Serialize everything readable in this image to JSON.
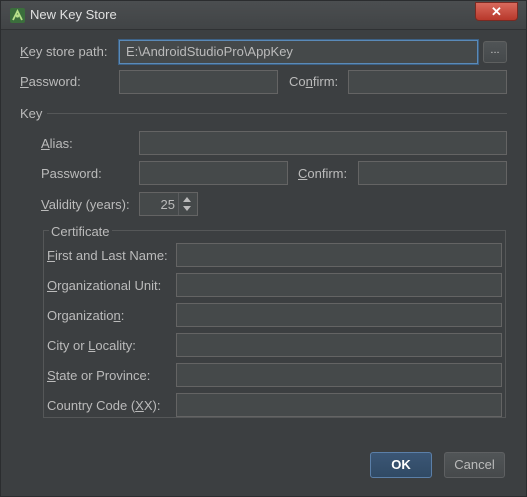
{
  "window": {
    "title": "New Key Store",
    "close_label": "✕"
  },
  "keystore": {
    "path_label_u": "K",
    "path_label_rest": "ey store path:",
    "path_value": "E:\\AndroidStudioPro\\AppKey",
    "browse_label": "...",
    "password_label_u": "P",
    "password_label_rest": "assword:",
    "confirm_label_pre": "Co",
    "confirm_label_u": "n",
    "confirm_label_post": "firm:"
  },
  "key": {
    "section_title": "Key",
    "alias_label_u": "A",
    "alias_label_rest": "lias:",
    "password_label": "Password:",
    "confirm_label_u": "C",
    "confirm_label_rest": "onfirm:",
    "validity_label_u": "V",
    "validity_label_rest": "alidity (years):",
    "validity_value": "25"
  },
  "certificate": {
    "section_title": "Certificate",
    "first_last_u": "F",
    "first_last_rest": "irst and Last Name:",
    "org_unit_u": "O",
    "org_unit_rest": "rganizational Unit:",
    "org_pre": "Organizatio",
    "org_u": "n",
    "org_post": ":",
    "city_pre": "City or ",
    "city_u": "L",
    "city_post": "ocality:",
    "state_pre": "",
    "state_u": "S",
    "state_post": "tate or Province:",
    "country_pre": "Country Code (",
    "country_u": "X",
    "country_post": "X):"
  },
  "buttons": {
    "ok": "OK",
    "cancel": "Cancel"
  }
}
